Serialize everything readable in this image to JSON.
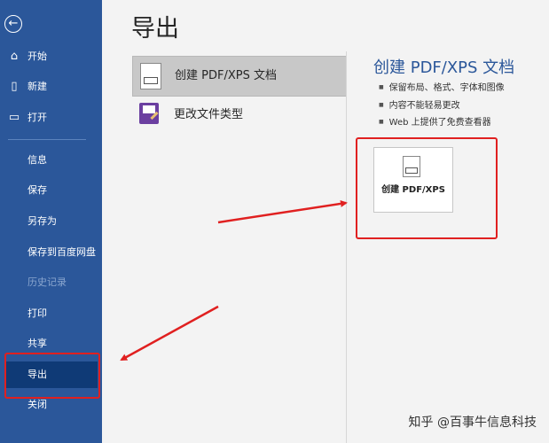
{
  "sidebar": {
    "back_icon": "arrow-left-circle-icon",
    "items": [
      {
        "label": "开始",
        "icon": "home-icon"
      },
      {
        "label": "新建",
        "icon": "new-document-icon"
      },
      {
        "label": "打开",
        "icon": "folder-open-icon"
      },
      {
        "label": "信息"
      },
      {
        "label": "保存"
      },
      {
        "label": "另存为"
      },
      {
        "label": "保存到百度网盘"
      },
      {
        "label": "历史记录",
        "disabled": true
      },
      {
        "label": "打印"
      },
      {
        "label": "共享"
      },
      {
        "label": "导出",
        "active": true
      },
      {
        "label": "关闭"
      }
    ]
  },
  "main": {
    "title": "导出",
    "options": [
      {
        "label": "创建 PDF/XPS 文档",
        "icon": "pdf-document-icon",
        "selected": true
      },
      {
        "label": "更改文件类型",
        "icon": "change-filetype-icon"
      }
    ],
    "panel": {
      "title": "创建 PDF/XPS 文档",
      "bullets": [
        "保留布局、格式、字体和图像",
        "内容不能轻易更改",
        "Web 上提供了免费查看器"
      ],
      "button_label": "创建 PDF/XPS"
    }
  },
  "watermark": "知乎 @百事牛信息科技",
  "colors": {
    "sidebar": "#2b579a",
    "active_item": "#0f3a76",
    "annotation_red": "#e02020"
  }
}
